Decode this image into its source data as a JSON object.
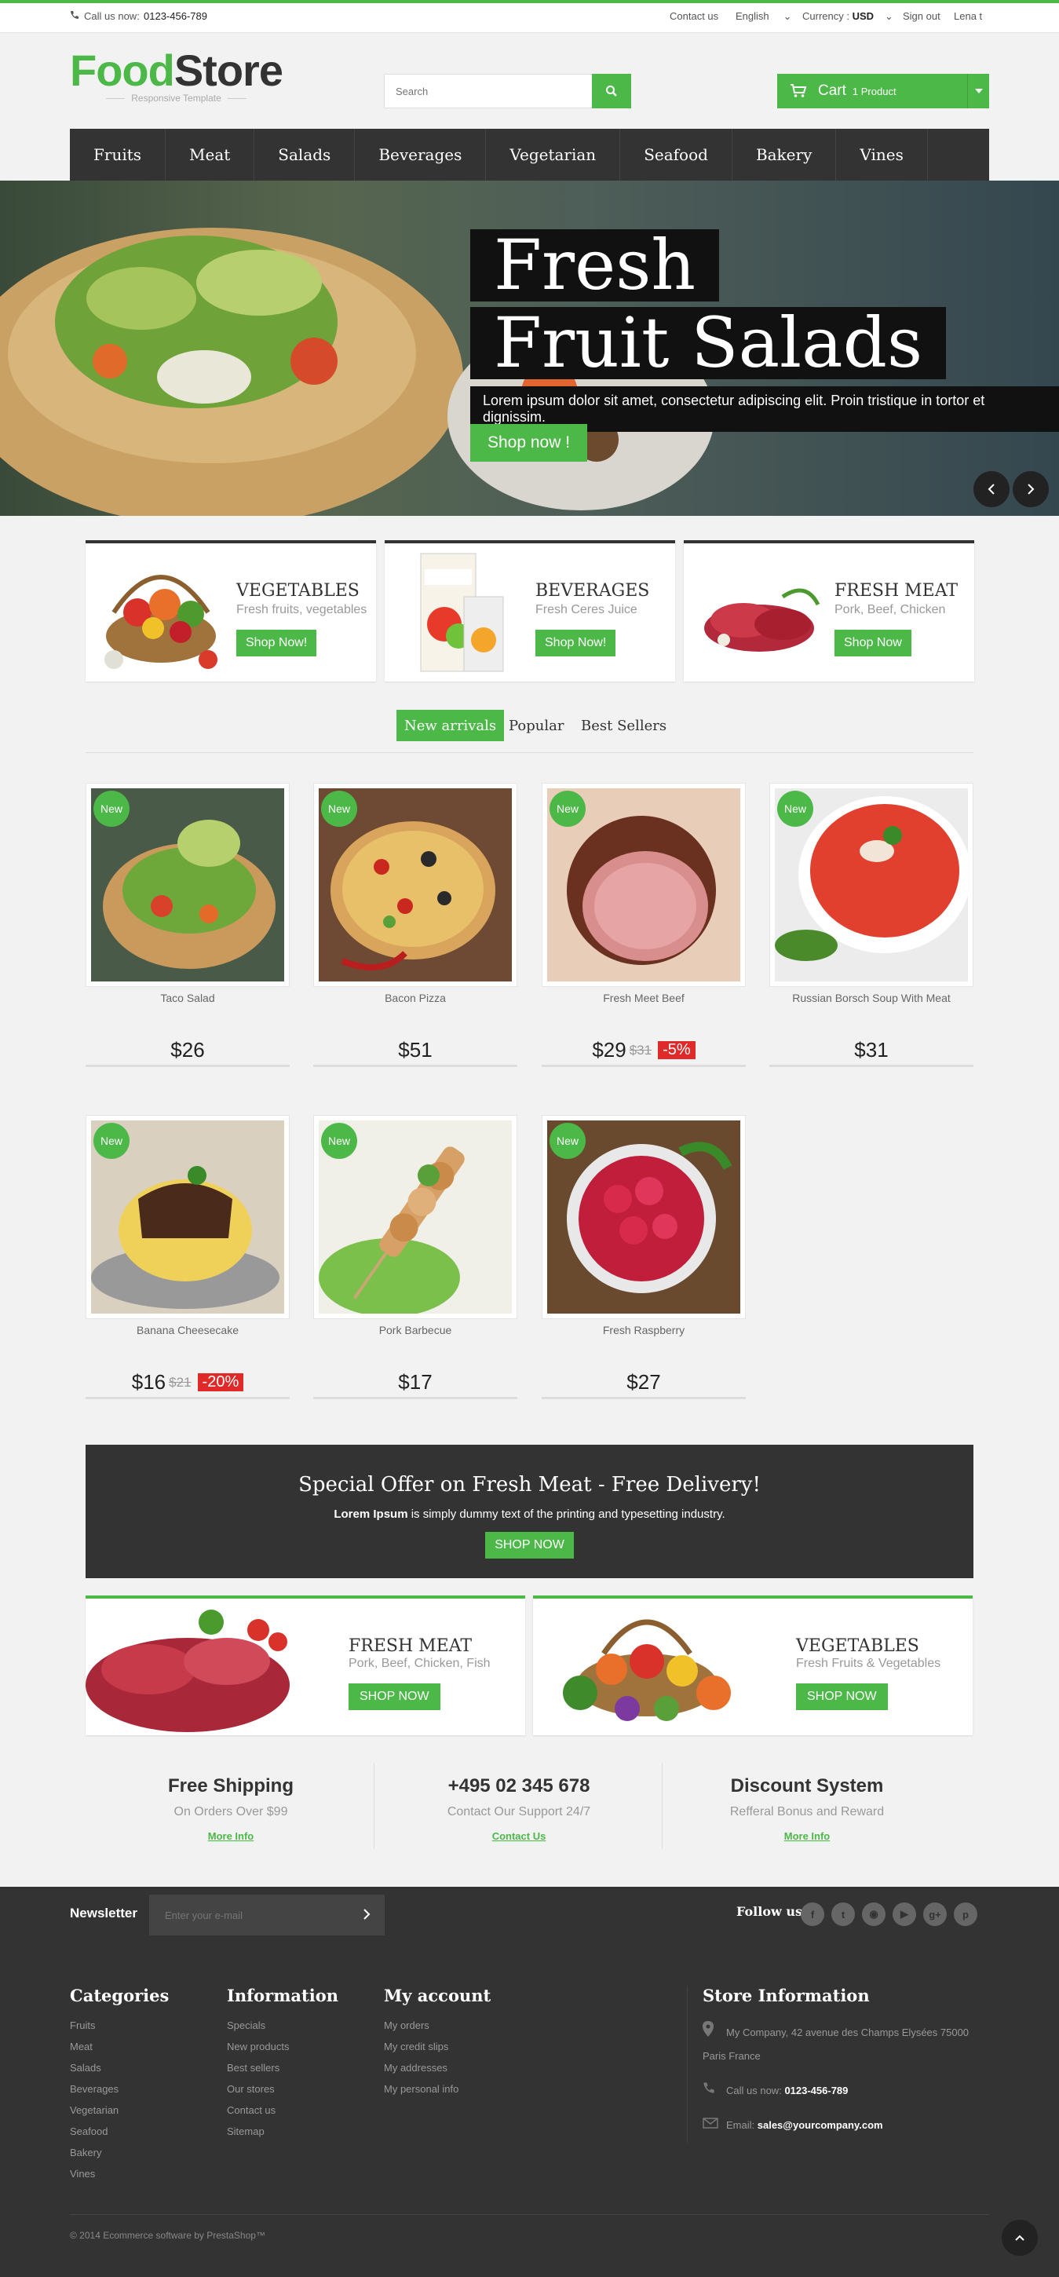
{
  "topbar": {
    "call_label": "Call us now:",
    "phone": "0123-456-789",
    "contact": "Contact us",
    "language": "English",
    "currency_label": "Currency :",
    "currency": "USD",
    "signout": "Sign out",
    "user": "Lena t"
  },
  "logo": {
    "food": "Food",
    "store": "Store",
    "tagline": "Responsive Template"
  },
  "search": {
    "placeholder": "Search"
  },
  "cart": {
    "label": "Cart",
    "count": "1 Product"
  },
  "nav": [
    "Fruits",
    "Meat",
    "Salads",
    "Beverages",
    "Vegetarian",
    "Seafood",
    "Bakery",
    "Vines"
  ],
  "hero": {
    "line1": "Fresh",
    "line2": "Fruit Salads",
    "text": "Lorem ipsum dolor sit amet, consectetur adipiscing elit. Proin tristique in tortor et dignissim.",
    "button": "Shop now !"
  },
  "banners": [
    {
      "title": "VEGETABLES",
      "subtitle": "Fresh fruits, vegetables",
      "button": "Shop Now!"
    },
    {
      "title": "BEVERAGES",
      "subtitle": "Fresh Ceres Juice",
      "button": "Shop Now!"
    },
    {
      "title": "FRESH MEAT",
      "subtitle": "Pork, Beef, Chicken",
      "button": "Shop Now"
    }
  ],
  "tabs": [
    "New arrivals",
    "Popular",
    "Best Sellers"
  ],
  "badge": "New",
  "products": [
    {
      "name": "Taco Salad",
      "price": "$26",
      "old": "",
      "disc": ""
    },
    {
      "name": "Bacon Pizza",
      "price": "$51",
      "old": "",
      "disc": ""
    },
    {
      "name": "Fresh Meet Beef",
      "price": "$29",
      "old": "$31",
      "disc": "-5%"
    },
    {
      "name": "Russian Borsch Soup With Meat",
      "price": "$31",
      "old": "",
      "disc": ""
    },
    {
      "name": "Banana Cheesecake",
      "price": "$16",
      "old": "$21",
      "disc": "-20%"
    },
    {
      "name": "Pork Barbecue",
      "price": "$17",
      "old": "",
      "disc": ""
    },
    {
      "name": "Fresh Raspberry",
      "price": "$27",
      "old": "",
      "disc": ""
    }
  ],
  "offer": {
    "title": "Special Offer on Fresh Meat - Free Delivery!",
    "bold": "Lorem Ipsum",
    "text": " is simply dummy text of the printing and typesetting industry.",
    "button": "SHOP NOW"
  },
  "bottom_banners": [
    {
      "title": "FRESH MEAT",
      "subtitle": "Pork, Beef, Chicken, Fish",
      "button": "SHOP NOW"
    },
    {
      "title": "VEGETABLES",
      "subtitle": "Fresh Fruits & Vegetables",
      "button": "SHOP NOW"
    }
  ],
  "info": [
    {
      "title": "Free Shipping",
      "sub": "On Orders Over $99",
      "link": "More Info"
    },
    {
      "title": "+495 02 345 678",
      "sub": "Contact Our Support 24/7",
      "link": "Contact Us"
    },
    {
      "title": "Discount System",
      "sub": "Refferal Bonus and Reward",
      "link": "More Info"
    }
  ],
  "footer": {
    "newsletter": "Newsletter",
    "email_placeholder": "Enter your e-mail",
    "follow": "Follow us",
    "categories": {
      "title": "Categories",
      "items": [
        "Fruits",
        "Meat",
        "Salads",
        "Beverages",
        "Vegetarian",
        "Seafood",
        "Bakery",
        "Vines"
      ]
    },
    "information": {
      "title": "Information",
      "items": [
        "Specials",
        "New products",
        "Best sellers",
        "Our stores",
        "Contact us",
        "Sitemap"
      ]
    },
    "account": {
      "title": "My account",
      "items": [
        "My orders",
        "My credit slips",
        "My addresses",
        "My personal info"
      ]
    },
    "store": {
      "title": "Store Information",
      "address1": "My Company, 42 avenue des Champs Elysées 75000",
      "address2": "Paris France",
      "call_label": "Call us now:",
      "phone": "0123-456-789",
      "email_label": "Email:",
      "email": "sales@yourcompany.com"
    },
    "copyright": "© 2014 Ecommerce software by PrestaShop™"
  },
  "colors": {
    "accent": "#4cb848",
    "dark": "#333333",
    "sale": "#e02a2a"
  }
}
